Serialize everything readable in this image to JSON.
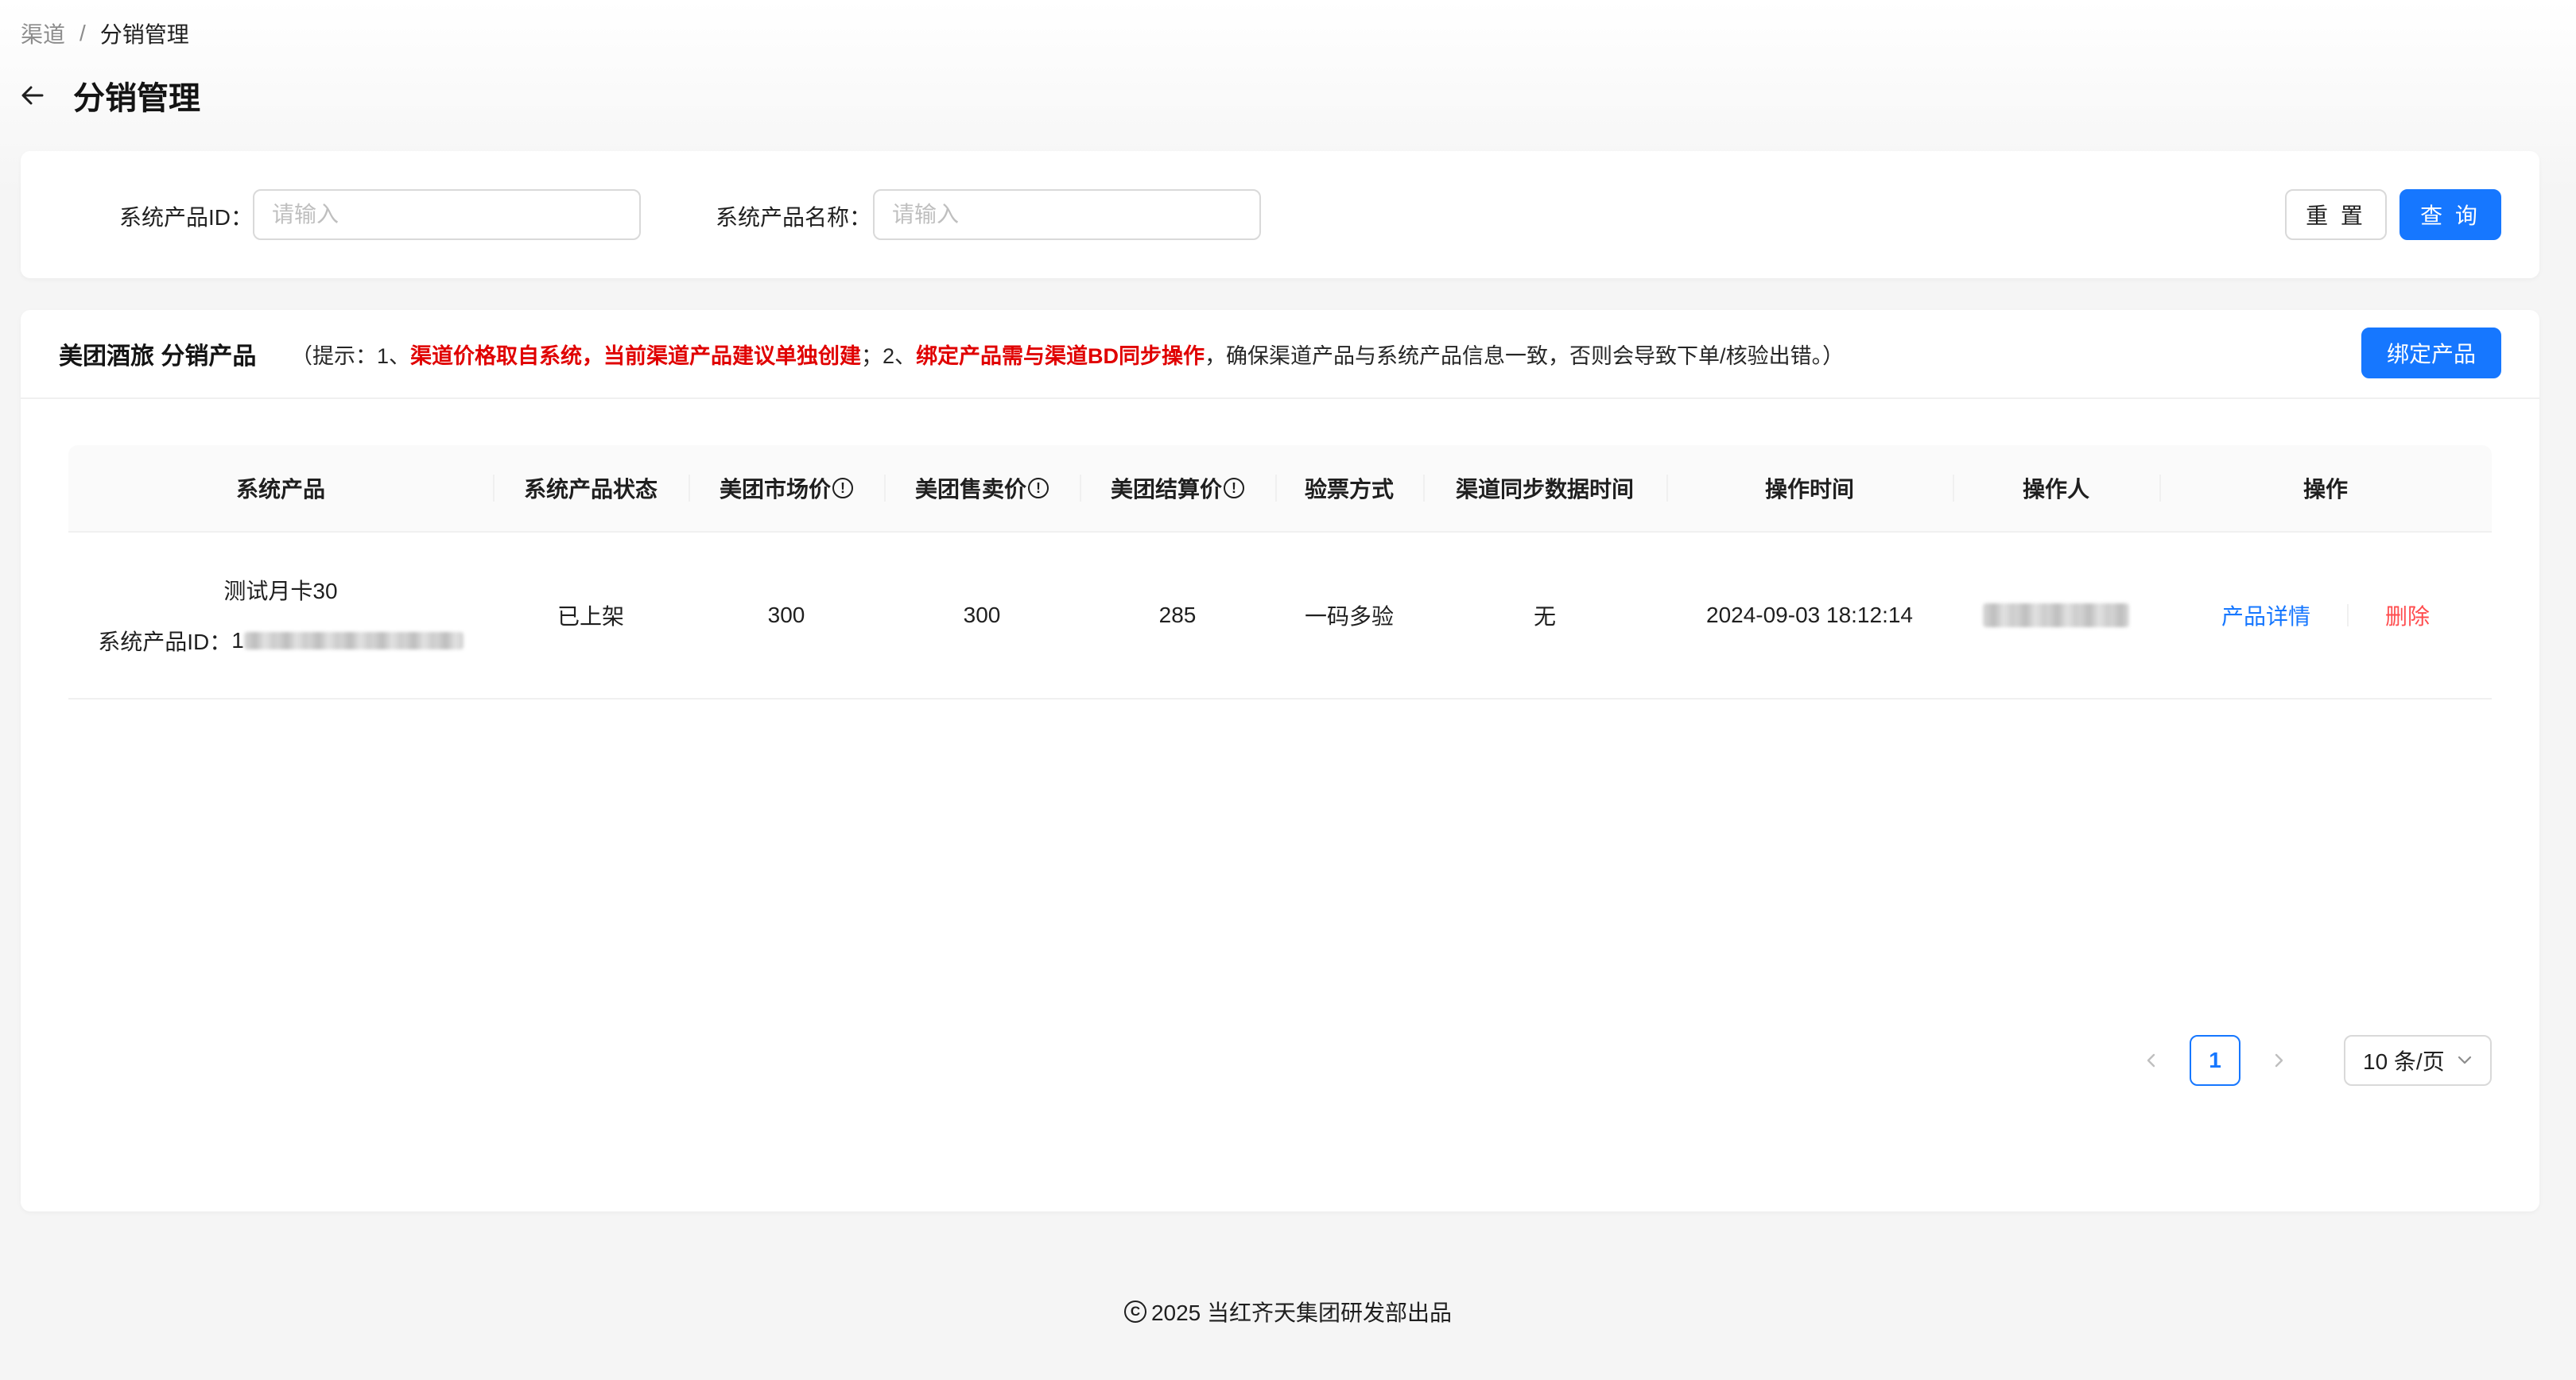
{
  "breadcrumb": {
    "root": "渠道",
    "separator": "/",
    "current": "分销管理"
  },
  "page": {
    "title": "分销管理"
  },
  "search": {
    "product_id_label": "系统产品ID：",
    "product_id_placeholder": "请输入",
    "product_name_label": "系统产品名称：",
    "product_name_placeholder": "请输入",
    "reset_label": "重 置",
    "query_label": "查 询"
  },
  "table_card": {
    "title": "美团酒旅 分销产品",
    "hint": {
      "prefix": "（提示：1、",
      "red1": "渠道价格取自系统，当前渠道产品建议单独创建",
      "mid": "；2、",
      "red2": "绑定产品需与渠道BD同步操作",
      "suffix": "，确保渠道产品与系统产品信息一致，否则会导致下单/核验出错。）"
    },
    "bind_button": "绑定产品"
  },
  "table": {
    "columns": [
      "系统产品",
      "系统产品状态",
      "美团市场价",
      "美团售卖价",
      "美团结算价",
      "验票方式",
      "渠道同步数据时间",
      "操作时间",
      "操作人",
      "操作"
    ],
    "info_glyph": "!",
    "rows": [
      {
        "product_name": "测试月卡30",
        "product_id_label": "系统产品ID：",
        "product_id_visible": "1",
        "status": "已上架",
        "market_price": "300",
        "sale_price": "300",
        "settle_price": "285",
        "verify_method": "一码多验",
        "sync_time": "无",
        "op_time": "2024-09-03 18:12:14",
        "detail_action": "产品详情",
        "delete_action": "删除"
      }
    ]
  },
  "pagination": {
    "current_page": "1",
    "page_size": "10 条/页"
  },
  "footer": {
    "text": "2025 当红齐天集团研发部出品",
    "copyright_glyph": "C"
  }
}
